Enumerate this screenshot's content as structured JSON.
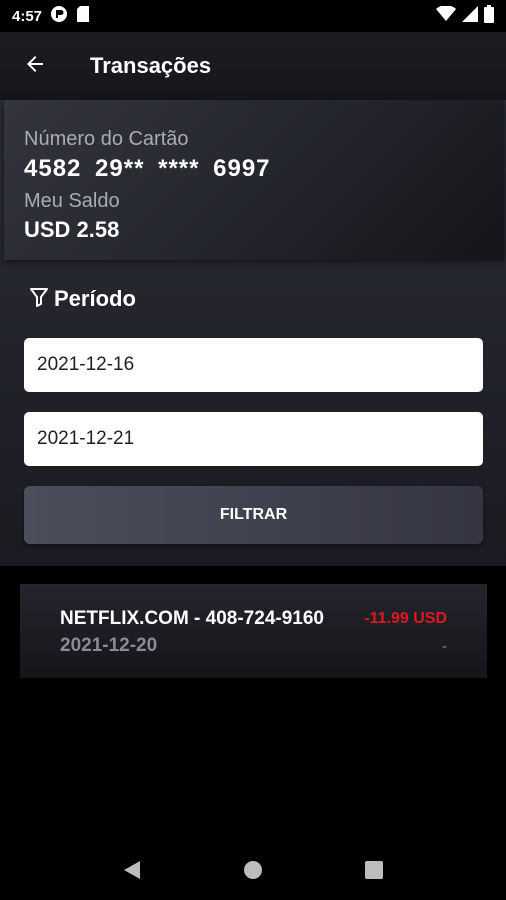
{
  "status_bar": {
    "time": "4:57",
    "icons_left": [
      "app-badge-icon",
      "sd-card-icon"
    ],
    "icons_right": [
      "wifi-icon",
      "cellular-signal-icon",
      "battery-icon"
    ]
  },
  "app_bar": {
    "back_icon": "arrow-left-icon",
    "title": "Transações"
  },
  "card": {
    "number_label": "Número do Cartão",
    "number": "4582 29** **** 6997",
    "balance_label": "Meu Saldo",
    "balance": "USD 2.58"
  },
  "period": {
    "icon": "filter-icon",
    "title": "Período",
    "start_date": "2021-12-16",
    "end_date": "2021-12-21",
    "filter_label": "FILTRAR"
  },
  "transactions": [
    {
      "merchant": "NETFLIX.COM - 408-724-9160",
      "date": "2021-12-20",
      "amount": "-11.99 USD",
      "detail": "-"
    }
  ],
  "colors": {
    "negative_amount": "#e01620",
    "muted_text": "#8a8b92"
  },
  "nav_bar": {
    "buttons": [
      "back-triangle-icon",
      "home-circle-icon",
      "recents-square-icon"
    ]
  }
}
